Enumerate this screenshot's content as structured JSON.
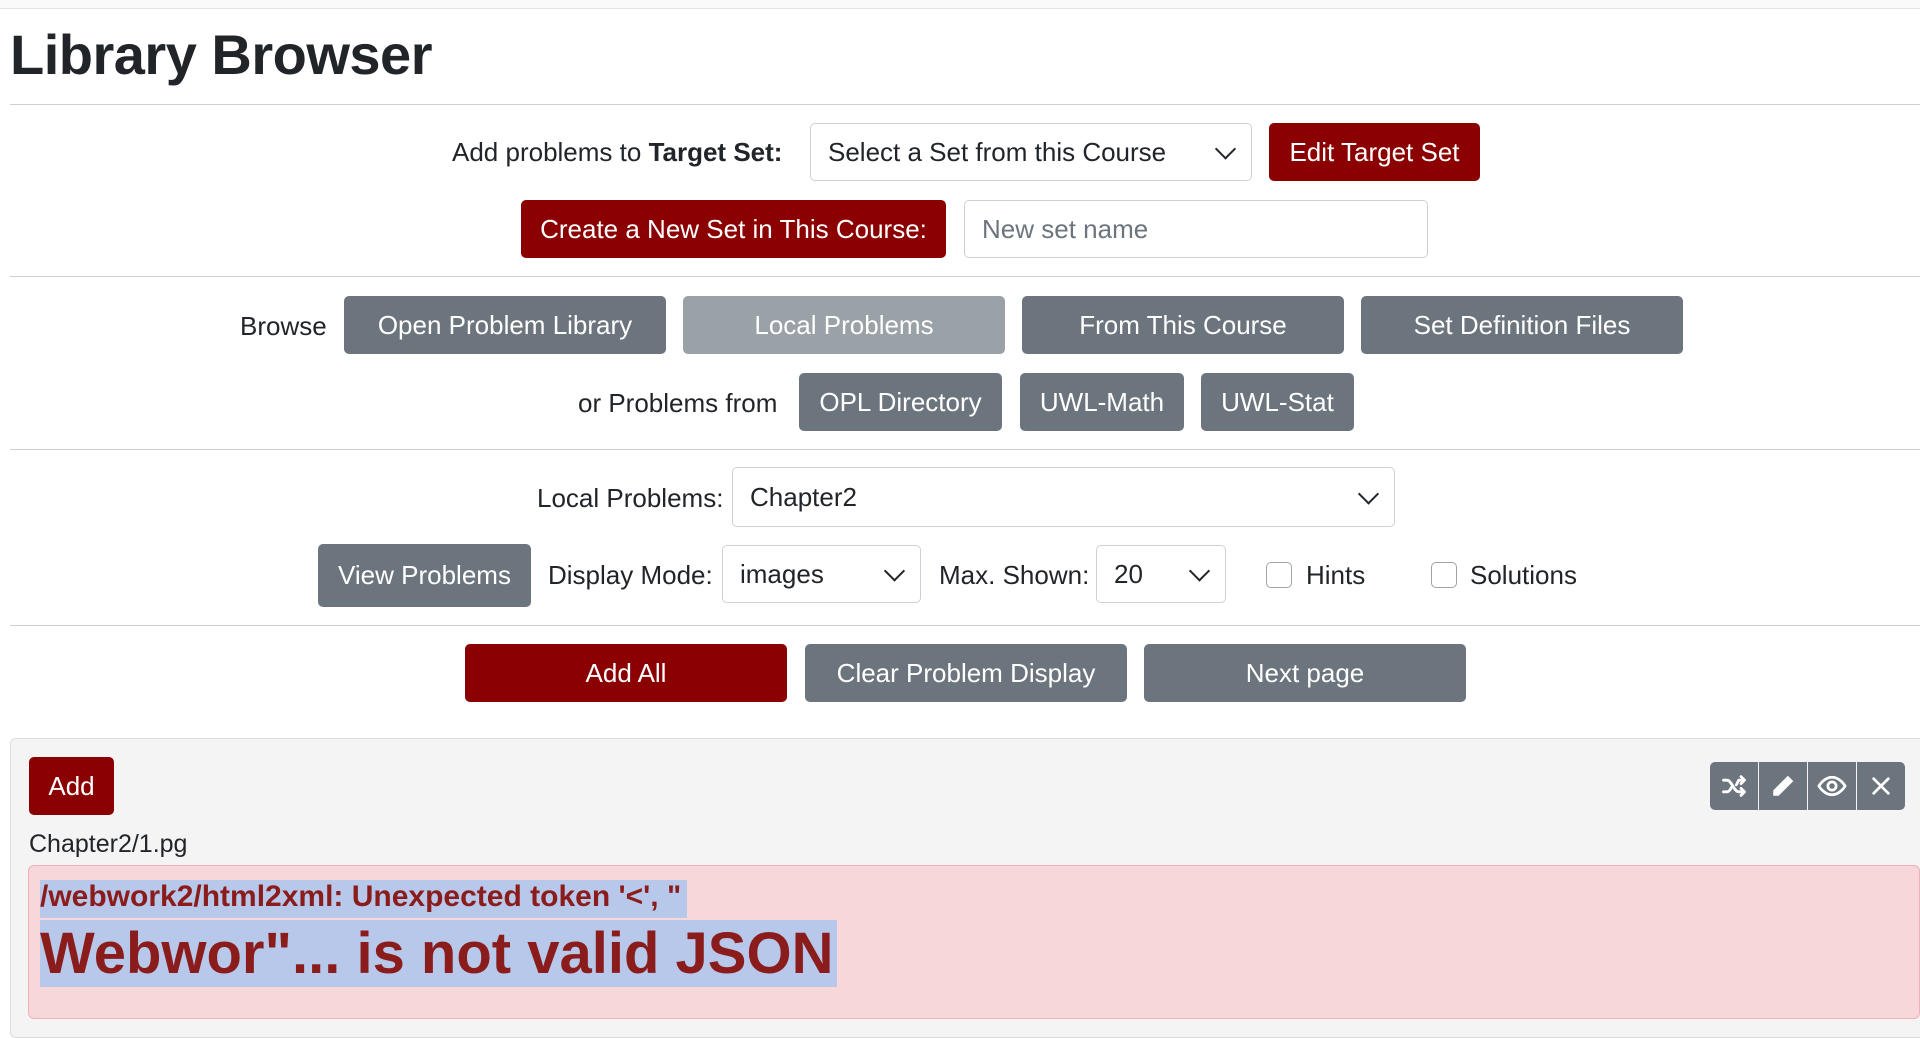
{
  "page": {
    "title": "Library Browser"
  },
  "target": {
    "label_prefix": "Add problems to",
    "label_bold": "Target Set:",
    "set_select_value": "Select a Set from this Course",
    "edit_button": "Edit Target Set",
    "create_button": "Create a New Set in This Course:",
    "new_set_placeholder": "New set name"
  },
  "browse": {
    "label": "Browse",
    "buttons": [
      "Open Problem Library",
      "Local Problems",
      "From This Course",
      "Set Definition Files"
    ],
    "active": "Local Problems",
    "or_label": "or Problems from",
    "sources": [
      "OPL Directory",
      "UWL-Math",
      "UWL-Stat"
    ]
  },
  "local": {
    "label": "Local Problems:",
    "selected": "Chapter2",
    "view_button": "View Problems",
    "display_mode_label": "Display Mode:",
    "display_mode_value": "images",
    "max_shown_label": "Max. Shown:",
    "max_shown_value": "20",
    "hints_label": "Hints",
    "hints_checked": false,
    "solutions_label": "Solutions",
    "solutions_checked": false
  },
  "actions": {
    "add_all": "Add All",
    "clear": "Clear Problem Display",
    "next": "Next page"
  },
  "problem": {
    "add_button": "Add",
    "path": "Chapter2/1.pg",
    "tools": [
      "shuffle-icon",
      "pencil-icon",
      "eye-icon",
      "close-icon"
    ],
    "error_line1": "/webwork2/html2xml: Unexpected token '<', \"",
    "error_line2": "Webwor\"... is not valid JSON"
  },
  "colors": {
    "primary": "#8b0000",
    "secondary": "#6c757d",
    "alert_bg": "#f8d7da",
    "alert_text": "#8a1c1c",
    "selection": "#b7c8ea"
  }
}
